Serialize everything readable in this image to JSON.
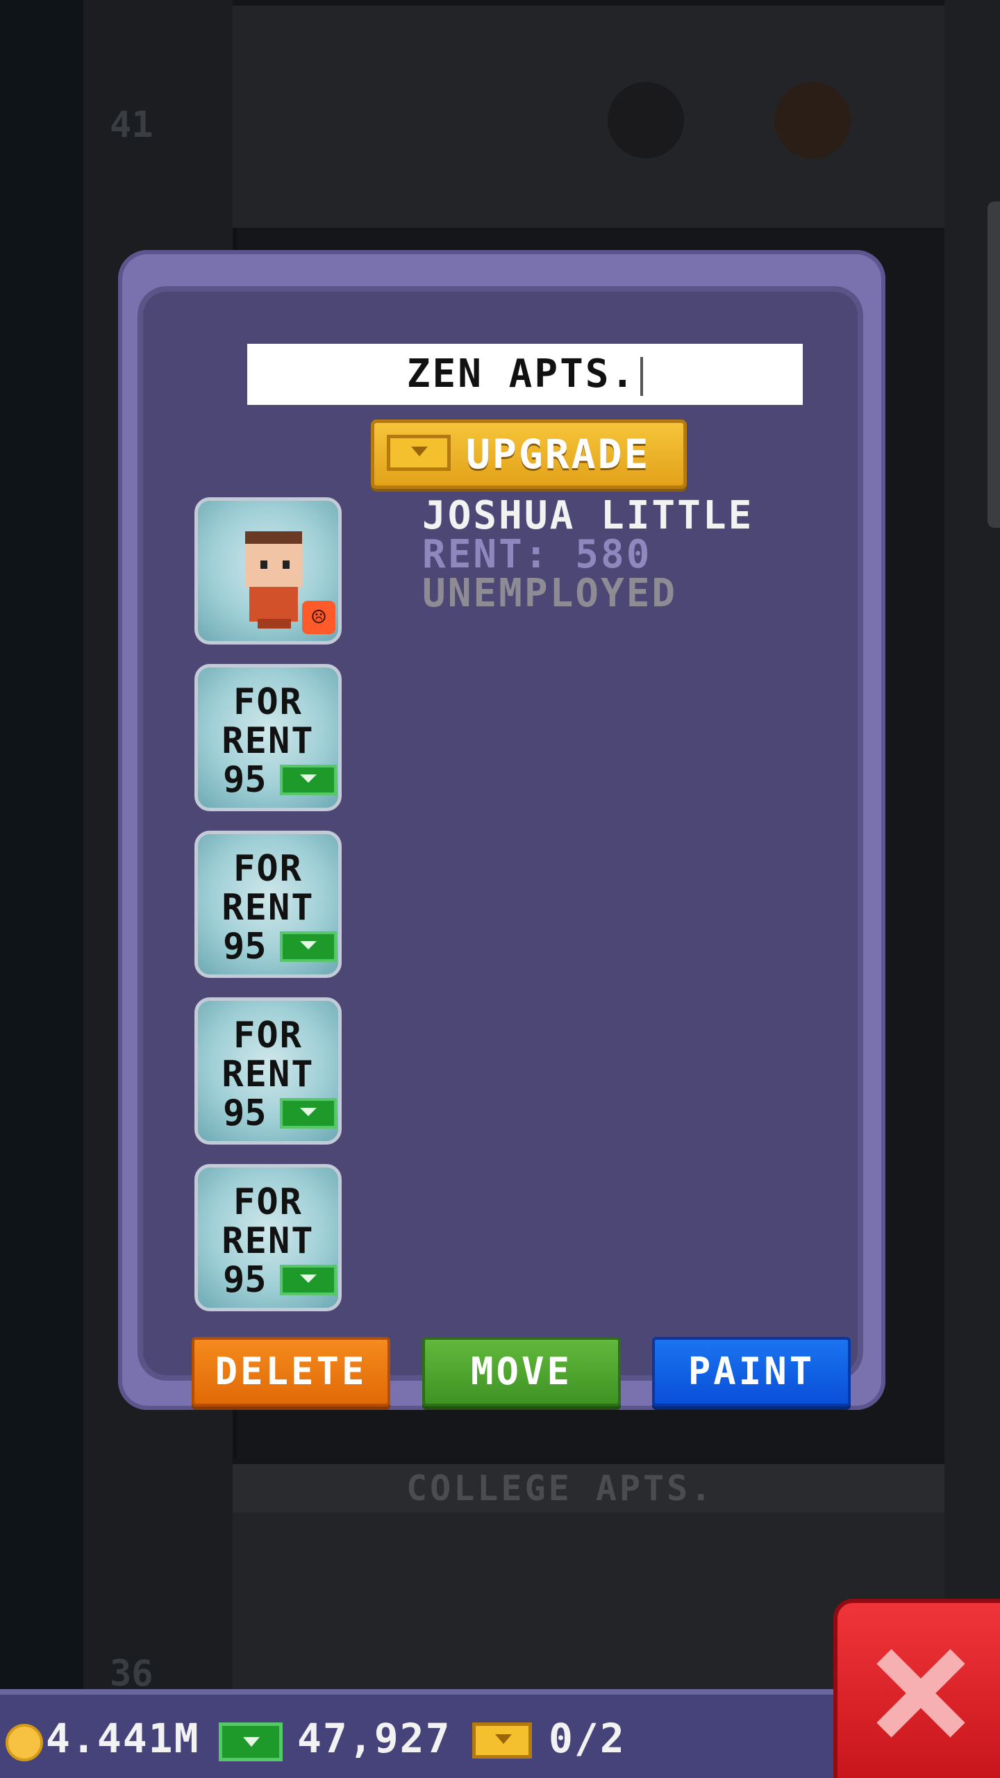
{
  "background": {
    "floor_top_label": "",
    "floor_number_top": "41",
    "floor_bottom_label": "COLLEGE APTS.",
    "floor_number_bottom": "36"
  },
  "dialog": {
    "floor_name_value": "ZEN APTS.",
    "upgrade_label": "UPGRADE",
    "resident": {
      "name": "JOSHUA LITTLE",
      "rent": "RENT: 580",
      "job": "UNEMPLOYED",
      "mood": "unhappy"
    },
    "vacant_units": [
      {
        "line1": "FOR",
        "line2": "RENT",
        "price": "95"
      },
      {
        "line1": "FOR",
        "line2": "RENT",
        "price": "95"
      },
      {
        "line1": "FOR",
        "line2": "RENT",
        "price": "95"
      },
      {
        "line1": "FOR",
        "line2": "RENT",
        "price": "95"
      }
    ],
    "actions": {
      "delete": "DELETE",
      "move": "MOVE",
      "paint": "PAINT"
    }
  },
  "status_bar": {
    "coins": "4.441M",
    "bux_cash": "47,927",
    "golden_bux": "0/2"
  },
  "colors": {
    "dialog_frame": "#7a72ae",
    "dialog_body": "#4c4774",
    "upgrade": "#f6c43a",
    "delete": "#f58a1e",
    "move": "#62b83c",
    "paint": "#1a74f0",
    "close": "#e0262c"
  }
}
